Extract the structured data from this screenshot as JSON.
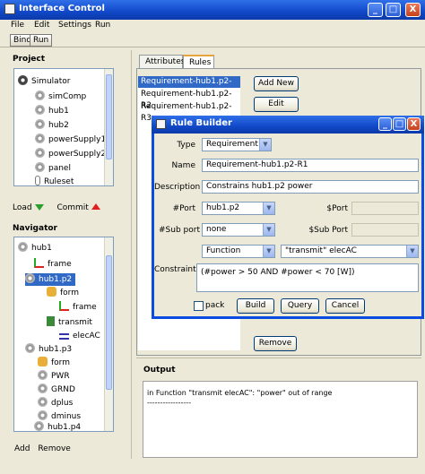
{
  "window": {
    "title": "Interface Control",
    "controls": [
      "_",
      "□",
      "X"
    ]
  },
  "menu": [
    "File",
    "Edit",
    "Settings",
    "Run"
  ],
  "toolbar": {
    "bind": "Bind",
    "run": "Run"
  },
  "project": {
    "label": "Project",
    "items": [
      "Simulator",
      "simComp",
      "hub1",
      "hub2",
      "powerSupply1",
      "powerSupply2",
      "panel",
      "Ruleset"
    ]
  },
  "project_actions": {
    "load": "Load",
    "commit": "Commit"
  },
  "navigator": {
    "label": "Navigator",
    "items": [
      "hub1",
      "frame",
      "hub1.p2",
      "form",
      "frame",
      "transmit",
      "elecAC",
      "hub1.p3",
      "form",
      "PWR",
      "GRND",
      "dplus",
      "dminus",
      "hub1.p4"
    ]
  },
  "navigator_actions": {
    "add": "Add",
    "remove": "Remove"
  },
  "tabs": [
    "Attributes",
    "Rules"
  ],
  "rules": [
    "Requirement-hub1.p2-R1",
    "Requirement-hub1.p2-R2",
    "Requirement-hub1.p2-R3"
  ],
  "rules_buttons": {
    "add_new": "Add New",
    "edit": "Edit",
    "remove": "Remove"
  },
  "output": {
    "label": "Output",
    "line1": "in Function \"transmit elecAC\": \"power\" out of range",
    "line2": "-----------------"
  },
  "dialog": {
    "title": "Rule Builder",
    "type_label": "Type",
    "type_value": "Requirement",
    "name_label": "Name",
    "name_value": "Requirement-hub1.p2-R1",
    "description_label": "Description",
    "description_value": "Constrains hub1.p2 power",
    "port_label": "#Port",
    "port_value": "hub1.p2",
    "sport_label": "$Port",
    "subport_label": "#Sub port",
    "subport_value": "none",
    "ssubport_label": "$Sub Port",
    "func_value": "Function",
    "func_target_value": "\"transmit\" elecAC",
    "constraint_label": "Constraint",
    "constraint_value": "(#power > 50 AND #power < 70 [W])",
    "pack_label": "pack",
    "build_label": "Build",
    "query_label": "Query",
    "cancel_label": "Cancel"
  }
}
